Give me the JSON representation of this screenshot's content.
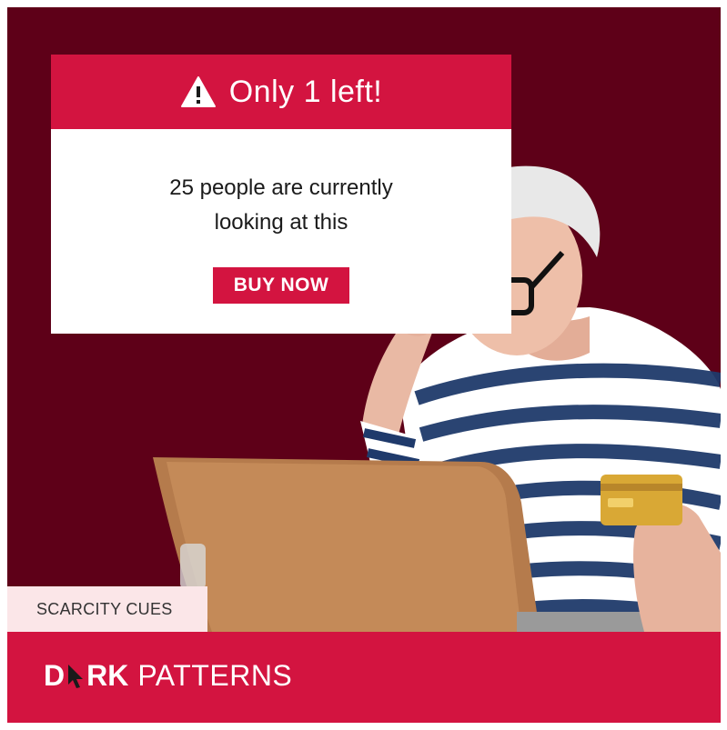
{
  "popup": {
    "title": "Only 1 left!",
    "message_line1": "25 people are currently",
    "message_line2": "looking at this",
    "button_label": "BUY NOW",
    "icon": "warning-icon"
  },
  "tag": {
    "label": "SCARCITY CUES"
  },
  "brand": {
    "part1": "D",
    "part2": "RK",
    "part3": "PATTERNS",
    "cursor_icon": "cursor-arrow-icon"
  },
  "colors": {
    "brand_red": "#d31440",
    "background_maroon": "#5e0018",
    "tag_pink": "#fbe6e8"
  }
}
